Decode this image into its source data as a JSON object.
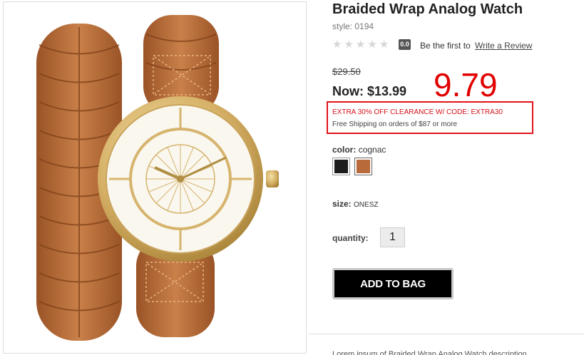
{
  "product": {
    "title": "Braided Wrap Analog Watch",
    "style": "style: 0194",
    "image_alt": "Braided wrap watch in cognac leather with gold case",
    "image_icon": "watch-product-photo"
  },
  "rating": {
    "stars": 5,
    "value": "0.0",
    "be_first_text": "Be the first to",
    "write_review_label": "Write a Review"
  },
  "pricing": {
    "original_price": "$29.50",
    "now_price": "Now: $13.99",
    "annotation": "9.79",
    "annotation_color": "#e00000"
  },
  "promo": {
    "code_text": "EXTRA 30% OFF CLEARANCE W/ CODE: EXTRA30",
    "shipping_text": "Free Shipping on orders of $87 or more",
    "highlight_color": "#e0141a"
  },
  "options": {
    "color_label": "color:",
    "color_value": "cognac",
    "swatches": [
      {
        "name": "black",
        "color": "#1c1c1c"
      },
      {
        "name": "cognac",
        "color": "#b86a3a"
      }
    ],
    "size_label": "size:",
    "size_value": "ONESZ",
    "quantity_label": "quantity:",
    "quantity_value": "1"
  },
  "actions": {
    "add_to_bag": "ADD TO BAG"
  },
  "footer": {
    "text": "Lorem ipsum of Braided Wrap Analog Watch description..."
  }
}
